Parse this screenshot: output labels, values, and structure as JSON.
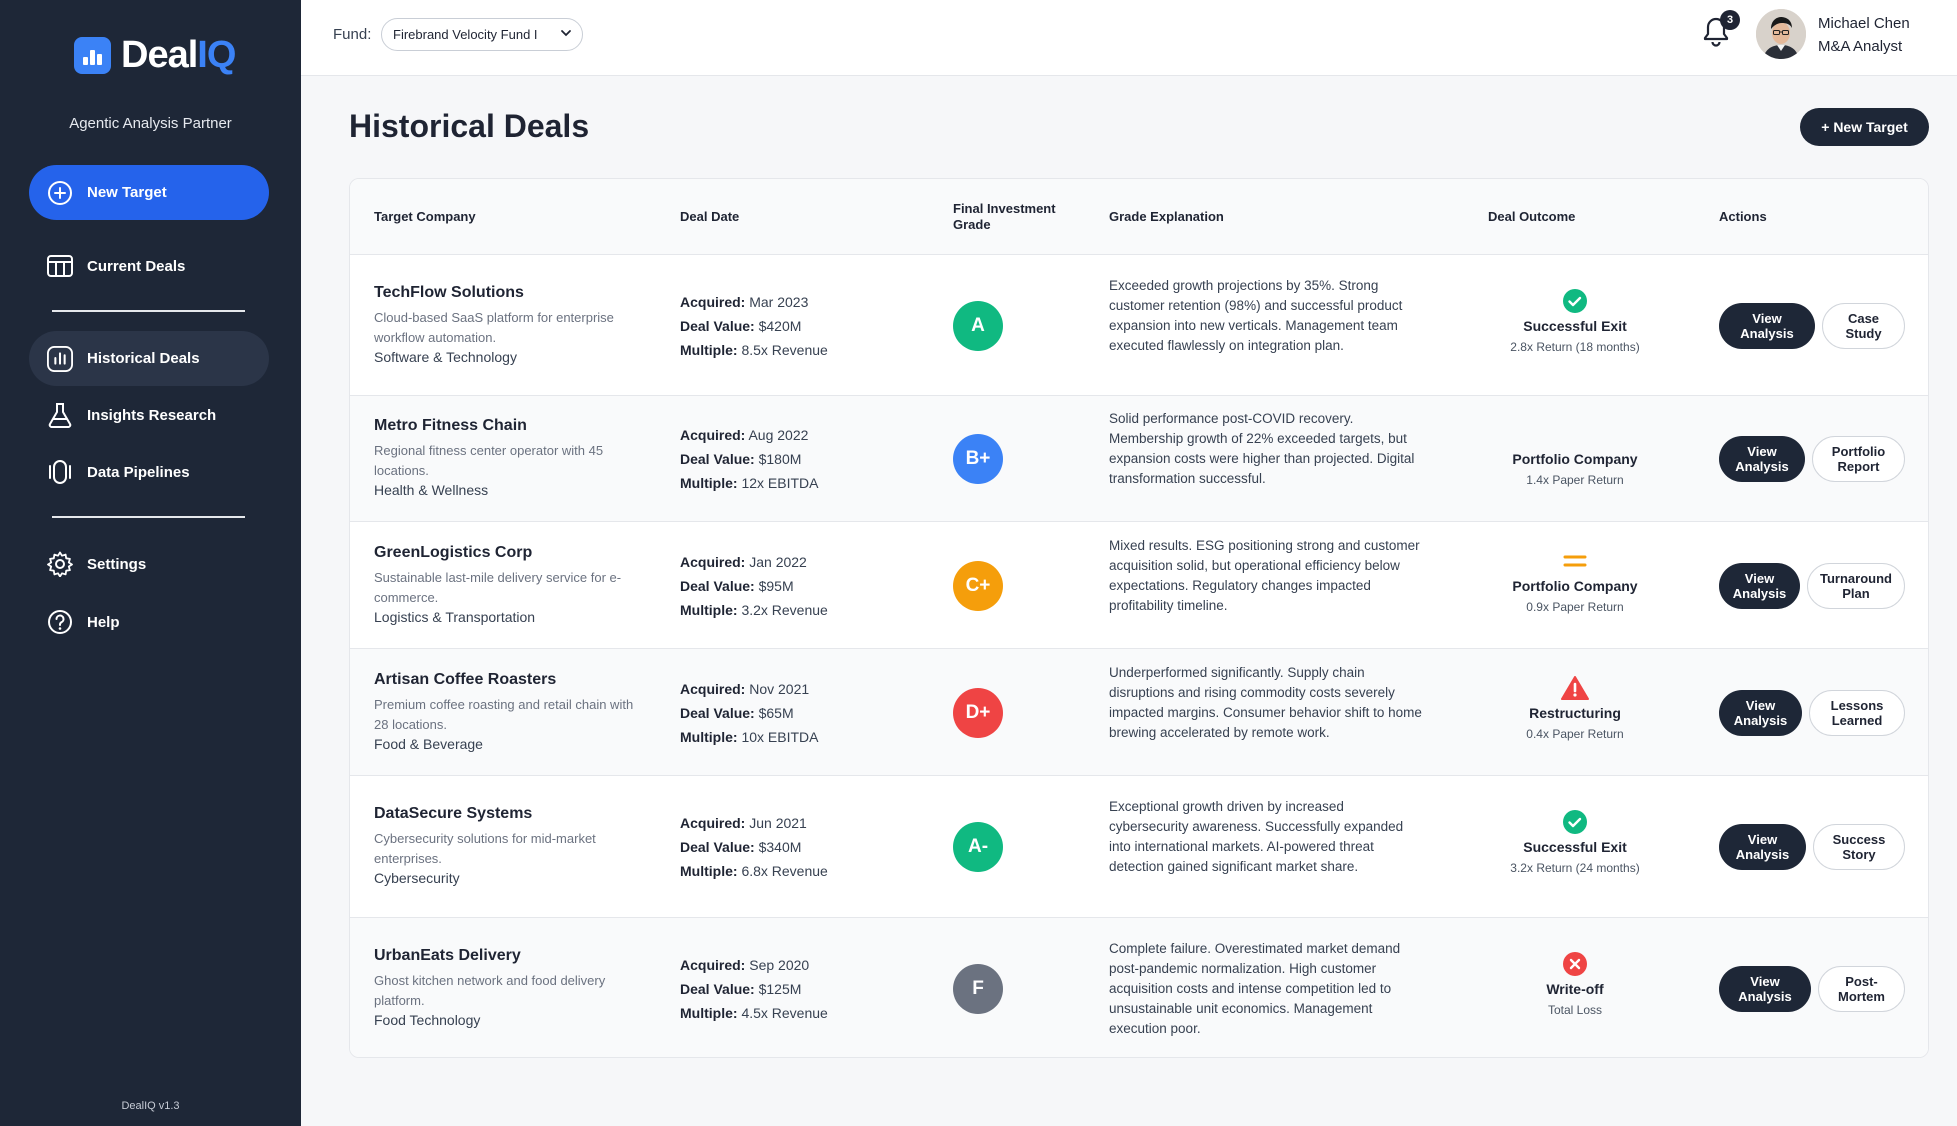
{
  "app": {
    "logo_main": "Deal",
    "logo_accent": "IQ",
    "tagline": "Agentic Analysis Partner",
    "version": "DealIQ v1.3"
  },
  "sidebar": {
    "new_target": "New Target",
    "current_deals": "Current Deals",
    "historical_deals": "Historical Deals",
    "insights_research": "Insights Research",
    "data_pipelines": "Data Pipelines",
    "settings": "Settings",
    "help": "Help"
  },
  "header": {
    "fund_label": "Fund:",
    "fund_value": "Firebrand Velocity Fund I",
    "notification_count": "3",
    "user_name": "Michael Chen",
    "user_role": "M&A Analyst"
  },
  "page": {
    "title": "Historical Deals",
    "new_target_button": "+ New Target"
  },
  "table": {
    "headers": {
      "company": "Target Company",
      "date": "Deal Date",
      "grade": "Final Investment Grade",
      "explanation": "Grade Explanation",
      "outcome": "Deal Outcome",
      "actions": "Actions"
    },
    "labels": {
      "acquired": "Acquired:",
      "deal_value": "Deal Value:",
      "multiple": "Multiple:"
    },
    "rows": [
      {
        "name": "TechFlow Solutions",
        "desc": "Cloud-based SaaS platform for enterprise workflow automation.",
        "sector": "Software & Technology",
        "acquired": "Mar 2023",
        "value": "$420M",
        "multiple": "8.5x Revenue",
        "grade": "A",
        "grade_color": "#10b981",
        "explanation": "Exceeded growth projections by 35%. Strong customer retention (98%) and successful product expansion into new verticals. Management team executed flawlessly on integration plan.",
        "outcome_icon": "check-circle-icon",
        "outcome": "Successful Exit",
        "outcome_sub": "2.8x Return (18 months)",
        "action1": "View Analysis",
        "action2": "Case Study"
      },
      {
        "name": "Metro Fitness Chain",
        "desc": "Regional fitness center operator with 45 locations.",
        "sector": "Health & Wellness",
        "acquired": "Aug 2022",
        "value": "$180M",
        "multiple": "12x EBITDA",
        "grade": "B+",
        "grade_color": "#3b82f6",
        "explanation": "Solid performance post-COVID recovery. Membership growth of 22% exceeded targets, but expansion costs were higher than projected. Digital transformation successful.",
        "outcome_icon": "",
        "outcome": "Portfolio Company",
        "outcome_sub": "1.4x Paper Return",
        "action1": "View Analysis",
        "action2": "Portfolio Report"
      },
      {
        "name": "GreenLogistics Corp",
        "desc": "Sustainable last-mile delivery service for e-commerce.",
        "sector": "Logistics & Transportation",
        "acquired": "Jan 2022",
        "value": "$95M",
        "multiple": "3.2x Revenue",
        "grade": "C+",
        "grade_color": "#f59e0b",
        "explanation": "Mixed results. ESG positioning strong and customer acquisition solid, but operational efficiency below expectations. Regulatory changes impacted profitability timeline.",
        "outcome_icon": "equals-icon",
        "outcome": "Portfolio Company",
        "outcome_sub": "0.9x Paper Return",
        "action1": "View Analysis",
        "action2": "Turnaround Plan"
      },
      {
        "name": "Artisan Coffee Roasters",
        "desc": "Premium coffee roasting and retail chain with 28 locations.",
        "sector": "Food & Beverage",
        "acquired": "Nov 2021",
        "value": "$65M",
        "multiple": "10x EBITDA",
        "grade": "D+",
        "grade_color": "#ef4444",
        "explanation": "Underperformed significantly. Supply chain disruptions and rising commodity costs severely impacted margins. Consumer behavior shift to home brewing accelerated by remote work.",
        "outcome_icon": "warning-icon",
        "outcome": "Restructuring",
        "outcome_sub": "0.4x Paper Return",
        "action1": "View Analysis",
        "action2": "Lessons Learned"
      },
      {
        "name": "DataSecure Systems",
        "desc": "Cybersecurity solutions for mid-market enterprises.",
        "sector": "Cybersecurity",
        "acquired": "Jun 2021",
        "value": "$340M",
        "multiple": "6.8x Revenue",
        "grade": "A-",
        "grade_color": "#10b981",
        "explanation": "Exceptional growth driven by increased cybersecurity awareness. Successfully expanded into international markets. AI-powered threat detection gained significant market share.",
        "outcome_icon": "check-circle-icon",
        "outcome": "Successful Exit",
        "outcome_sub": "3.2x Return (24 months)",
        "action1": "View Analysis",
        "action2": "Success Story"
      },
      {
        "name": "UrbanEats Delivery",
        "desc": "Ghost kitchen network and food delivery platform.",
        "sector": "Food Technology",
        "acquired": "Sep 2020",
        "value": "$125M",
        "multiple": "4.5x Revenue",
        "grade": "F",
        "grade_color": "#6b7280",
        "explanation": "Complete failure. Overestimated market demand post-pandemic normalization. High customer acquisition costs and intense competition led to unsustainable unit economics. Management execution poor.",
        "outcome_icon": "x-circle-icon",
        "outcome": "Write-off",
        "outcome_sub": "Total Loss",
        "action1": "View Analysis",
        "action2": "Post-Mortem"
      }
    ]
  }
}
